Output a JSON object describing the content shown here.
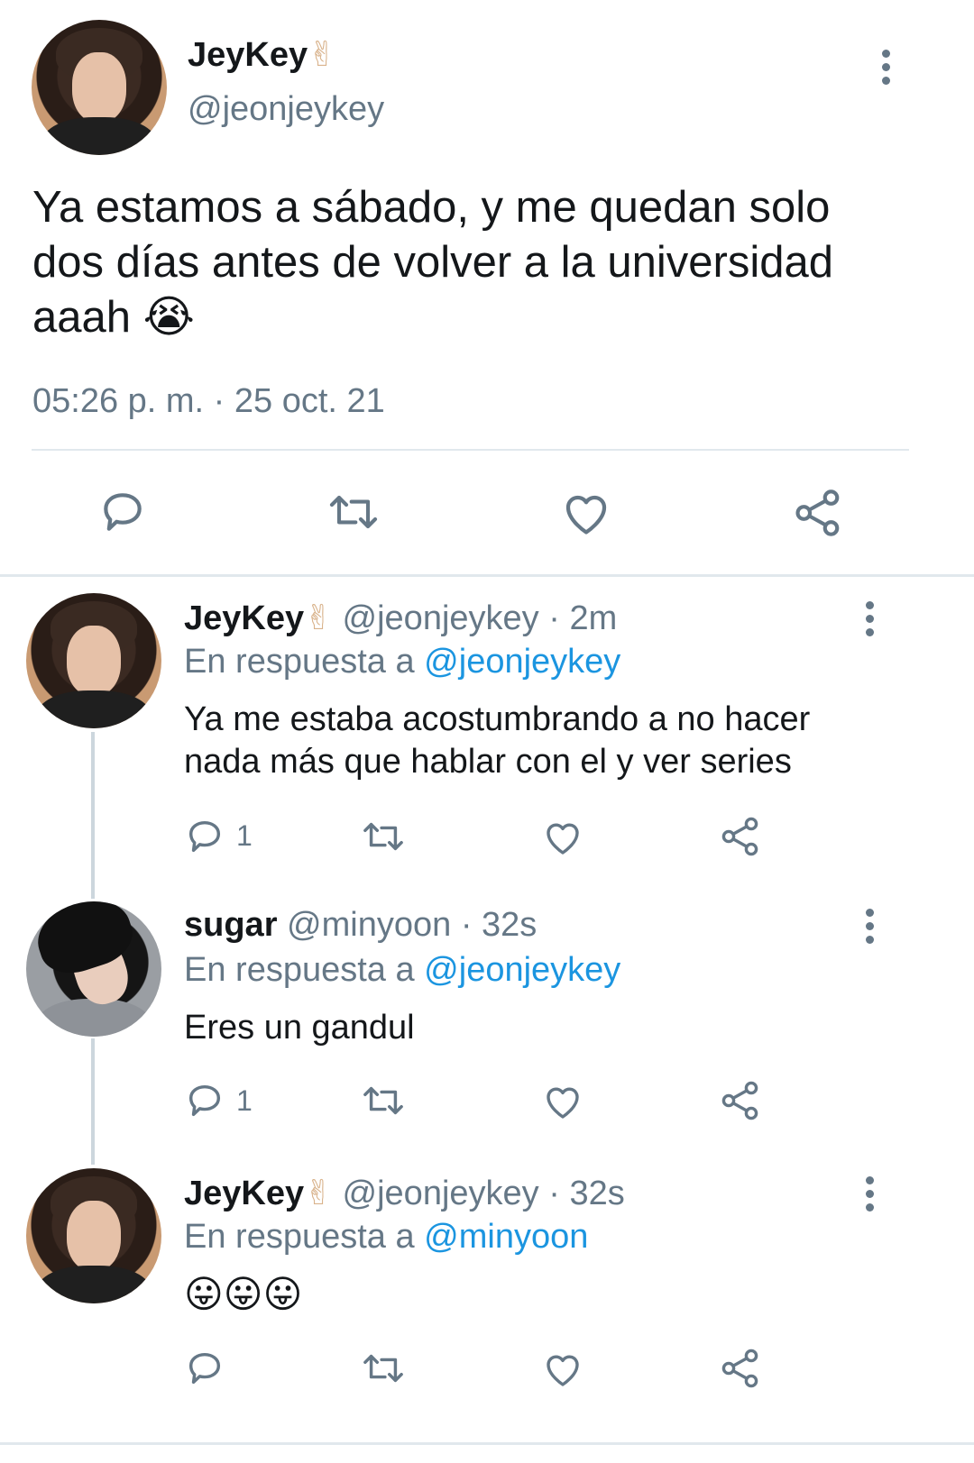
{
  "main_tweet": {
    "display_name": "JeyKey",
    "handle": "@jeonjeykey",
    "text_line1": "Ya estamos a sábado, y me quedan solo",
    "text_line2": "dos días antes de volver a la universidad",
    "text_line3": "aaah",
    "timestamp": "05:26 p. m. · 25 oct. 21"
  },
  "replies": [
    {
      "display_name": "JeyKey",
      "handle": "@jeonjeykey",
      "time": "· 2m",
      "reply_prefix": "En respuesta a",
      "reply_to": "@jeonjeykey",
      "text_line1": "Ya me estaba acostumbrando a no hacer",
      "text_line2": "nada más que hablar con el y ver series",
      "reply_count": "1"
    },
    {
      "display_name": "sugar",
      "handle": "@minyoon",
      "time": "· 32s",
      "reply_prefix": "En respuesta a",
      "reply_to": "@jeonjeykey",
      "text_line1": "Eres un gandul",
      "reply_count": "1"
    },
    {
      "display_name": "JeyKey",
      "handle": "@jeonjeykey",
      "time": "· 32s",
      "reply_prefix": "En respuesta a",
      "reply_to": "@minyoon",
      "text_line1": "😛😛😛",
      "reply_count": ""
    }
  ],
  "icons": {
    "reply": "reply-icon",
    "retweet": "retweet-icon",
    "like": "heart-icon",
    "share": "share-icon",
    "more": "more-vertical-icon",
    "victory_emoji": "✌",
    "crying_emoji": "😭"
  },
  "colors": {
    "text": "#14171a",
    "muted": "#657786",
    "link": "#1b95e0",
    "divider": "#e1e8ed"
  }
}
